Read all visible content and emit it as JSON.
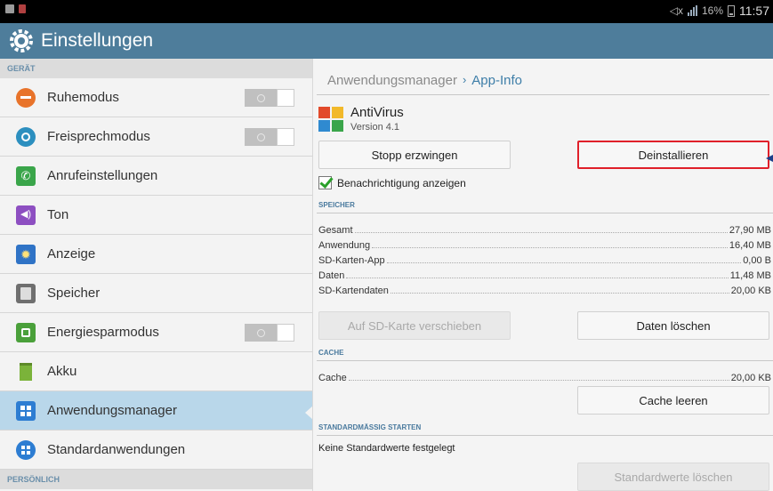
{
  "status_bar": {
    "battery": "16%",
    "time": "11:57"
  },
  "action_bar": {
    "title": "Einstellungen",
    "icon": "settings-gear-icon"
  },
  "sidebar": {
    "section_device": "GERÄT",
    "items": [
      {
        "label": "Ruhemodus",
        "icon": "sleep-mode-icon",
        "color": "#e8732a",
        "toggle": "off"
      },
      {
        "label": "Freisprechmodus",
        "icon": "hands-free-icon",
        "color": "#2c8fbf",
        "toggle": "off"
      },
      {
        "label": "Anrufeinstellungen",
        "icon": "call-settings-icon",
        "color": "#3aa54a"
      },
      {
        "label": "Ton",
        "icon": "sound-icon",
        "color": "#8d4fc1"
      },
      {
        "label": "Anzeige",
        "icon": "display-icon",
        "color": "#2f73c6"
      },
      {
        "label": "Speicher",
        "icon": "storage-icon",
        "color": "#6f6f6f"
      },
      {
        "label": "Energiesparmodus",
        "icon": "power-saving-icon",
        "color": "#4aa03a",
        "toggle": "off"
      },
      {
        "label": "Akku",
        "icon": "battery-icon",
        "color": "#7bb33a"
      },
      {
        "label": "Anwendungsmanager",
        "icon": "app-manager-icon",
        "color": "#2d7dd2",
        "selected": true
      },
      {
        "label": "Standardanwendungen",
        "icon": "default-apps-icon",
        "color": "#2d7dd2"
      }
    ],
    "section_personal": "PERSÖNLICH"
  },
  "detail": {
    "breadcrumb": {
      "parent": "Anwendungsmanager",
      "separator": "›",
      "current": "App-Info"
    },
    "app": {
      "name": "AntiVirus",
      "version": "Version 4.1"
    },
    "buttons": {
      "force_stop": "Stopp erzwingen",
      "uninstall": "Deinstallieren",
      "move_sd": "Auf SD-Karte verschieben",
      "clear_data": "Daten löschen",
      "clear_cache": "Cache leeren",
      "clear_defaults": "Standardwerte löschen"
    },
    "notification_checkbox": {
      "label": "Benachrichtigung anzeigen",
      "checked": true
    },
    "storage": {
      "header": "SPEICHER",
      "rows": [
        {
          "label": "Gesamt",
          "value": "27,90 MB"
        },
        {
          "label": "Anwendung",
          "value": "16,40 MB"
        },
        {
          "label": "SD-Karten-App",
          "value": "0,00 B"
        },
        {
          "label": "Daten",
          "value": "11,48 MB"
        },
        {
          "label": "SD-Kartendaten",
          "value": "20,00 KB"
        }
      ]
    },
    "cache": {
      "header": "CACHE",
      "rows": [
        {
          "label": "Cache",
          "value": "20,00 KB"
        }
      ]
    },
    "launch_default": {
      "header": "STANDARDMÄSSIG STARTEN",
      "text": "Keine Standardwerte festgelegt"
    }
  }
}
